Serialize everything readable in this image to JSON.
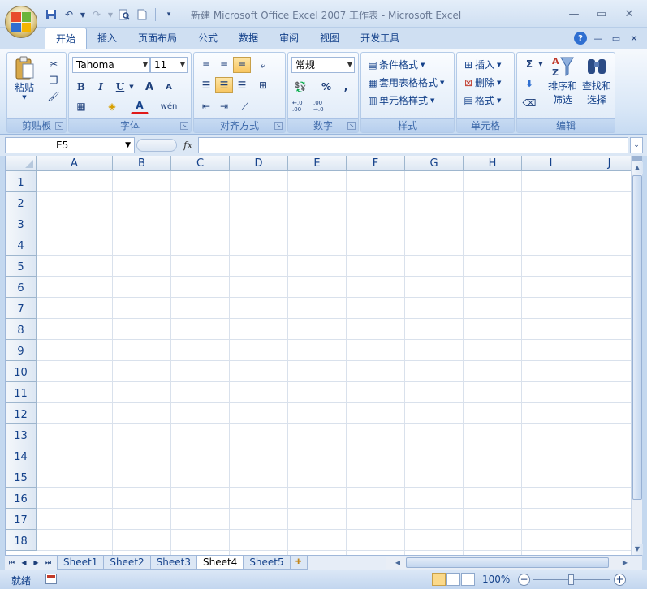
{
  "window": {
    "title": "新建 Microsoft Office Excel 2007 工作表 - Microsoft Excel",
    "controls": [
      "minimize",
      "restore",
      "close"
    ]
  },
  "ribbon": {
    "tabs": [
      "开始",
      "插入",
      "页面布局",
      "公式",
      "数据",
      "审阅",
      "视图",
      "开发工具"
    ],
    "active_tab": "开始",
    "groups": {
      "clipboard": {
        "label": "剪贴板",
        "paste_label": "粘贴"
      },
      "font": {
        "label": "字体",
        "font_name": "Tahoma",
        "font_size": "11",
        "bold": "B",
        "italic": "I",
        "underline": "U",
        "grow": "A",
        "shrink": "A",
        "font_color_letter": "A",
        "phonetic": "wén"
      },
      "alignment": {
        "label": "对齐方式"
      },
      "number": {
        "label": "数字",
        "format": "常规",
        "percent": "%",
        "comma": ",",
        "inc_decimal": "←.0 .00",
        "dec_decimal": ".00 →.0"
      },
      "styles": {
        "label": "样式",
        "conditional": "条件格式",
        "table_format": "套用表格格式",
        "cell_styles": "单元格样式"
      },
      "cells": {
        "label": "单元格",
        "insert": "插入",
        "delete": "删除",
        "format": "格式"
      },
      "editing": {
        "label": "编辑",
        "sort_filter_1": "排序和",
        "sort_filter_2": "筛选",
        "find_select_1": "查找和",
        "find_select_2": "选择",
        "sum_symbol": "Σ"
      }
    }
  },
  "formula_bar": {
    "name_box": "E5",
    "fx_label": "fx",
    "formula": ""
  },
  "sheet": {
    "columns": [
      "A",
      "B",
      "C",
      "D",
      "E",
      "F",
      "G",
      "H",
      "I",
      "J"
    ],
    "rows": [
      "1",
      "2",
      "3",
      "4",
      "5",
      "6",
      "7",
      "8",
      "9",
      "10",
      "11",
      "12",
      "13",
      "14",
      "15",
      "16",
      "17",
      "18"
    ]
  },
  "sheet_tabs": {
    "tabs": [
      "Sheet1",
      "Sheet2",
      "Sheet3",
      "Sheet4",
      "Sheet5"
    ],
    "active": "Sheet4"
  },
  "status_bar": {
    "status": "就绪",
    "zoom": "100%"
  },
  "colors": {
    "accent": "#15428b",
    "ribbon_bg": "#dbe7f6",
    "highlight": "#f8c55f"
  }
}
